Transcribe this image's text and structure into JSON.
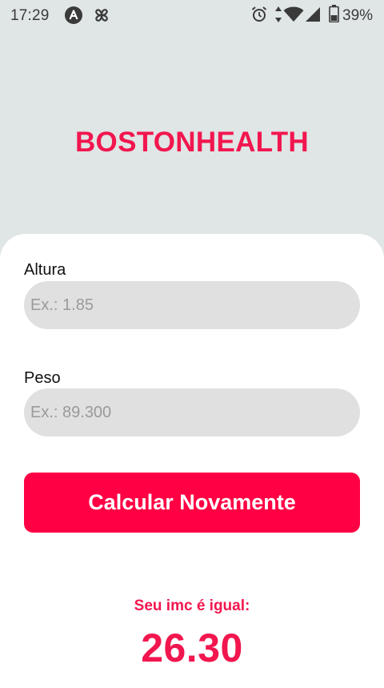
{
  "status_bar": {
    "time": "17:29",
    "battery_percent": "39%",
    "icons": [
      "app-a-icon",
      "pinwheel-icon",
      "alarm-icon",
      "data-arrows-icon",
      "wifi-icon",
      "signal-icon",
      "battery-icon"
    ]
  },
  "app": {
    "title": "BOSTONHEALTH"
  },
  "form": {
    "height_label": "Altura",
    "height_placeholder": "Ex.: 1.85",
    "height_value": "",
    "weight_label": "Peso",
    "weight_placeholder": "Ex.: 89.300",
    "weight_value": "",
    "button_label": "Calcular Novamente"
  },
  "result": {
    "caption": "Seu imc é igual:",
    "value": "26.30"
  },
  "colors": {
    "accent": "#f2164f",
    "button": "#ff0044",
    "header_background": "#e0e5e5",
    "input_background": "#e0e0e0"
  }
}
